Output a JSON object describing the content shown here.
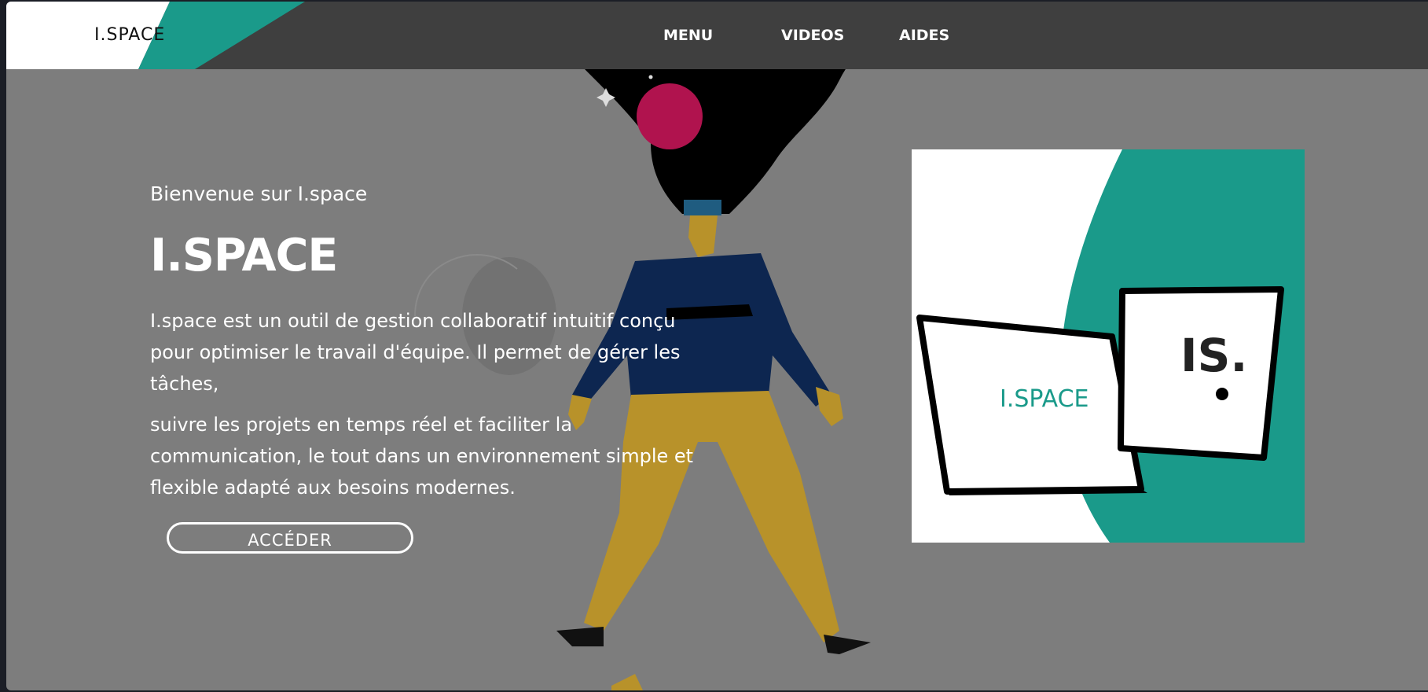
{
  "nav": {
    "logo_text": "I.SPACE",
    "links": [
      "MENU",
      "VIDEOS",
      "AIDES"
    ]
  },
  "hero": {
    "welcome": "Bienvenue sur I.space",
    "title": "I.SPACE",
    "paragraph1": "I.space est un outil de gestion collaboratif intuitif conçu pour optimiser le travail d'équipe. Il permet de gérer les tâches,",
    "paragraph2": "suivre les projets en temps réel et faciliter la communication, le tout dans un environnement simple et flexible adapté aux besoins modernes.",
    "button": "ACCÉDER"
  },
  "promo": {
    "laptop_logo": "I.SPACE",
    "tablet_logo": "IS."
  },
  "colors": {
    "accent": "#1a9a8a",
    "overlay": "#7d7d7d",
    "navbar": "#3f3f3f"
  }
}
